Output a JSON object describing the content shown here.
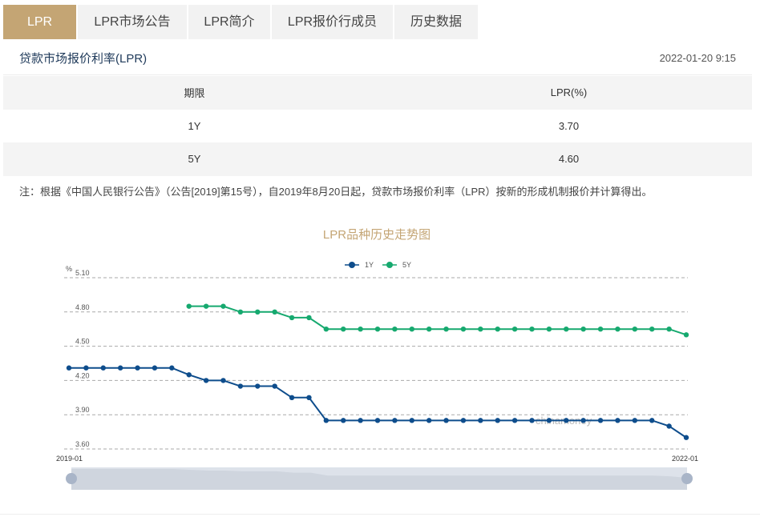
{
  "tabs": [
    {
      "label": "LPR",
      "active": true
    },
    {
      "label": "LPR市场公告"
    },
    {
      "label": "LPR简介"
    },
    {
      "label": "LPR报价行成员"
    },
    {
      "label": "历史数据"
    }
  ],
  "header": {
    "title": "贷款市场报价利率(LPR)",
    "date": "2022-01-20 9:15"
  },
  "table": {
    "headers": [
      "期限",
      "LPR(%)"
    ],
    "rows": [
      [
        "1Y",
        "3.70"
      ],
      [
        "5Y",
        "4.60"
      ]
    ]
  },
  "note": "注：根据《中国人民银行公告》（公告[2019]第15号），自2019年8月20日起，贷款市场报价利率（LPR）按新的形成机制报价并计算得出。",
  "chart_data": {
    "type": "line",
    "title": "LPR品种历史走势图",
    "ylabel": "%",
    "ylim": [
      3.6,
      5.1
    ],
    "yticks": [
      "5.10",
      "4.80",
      "4.50",
      "4.20",
      "3.90",
      "3.60"
    ],
    "x_start": "2019-01",
    "x_end": "2022-01",
    "watermark": "chinamoney",
    "grid": true,
    "legend": "top-center",
    "series": [
      {
        "name": "1Y",
        "color": "#0e4d8c",
        "values": [
          4.31,
          4.31,
          4.31,
          4.31,
          4.31,
          4.31,
          4.31,
          4.25,
          4.2,
          4.2,
          4.15,
          4.15,
          4.15,
          4.05,
          4.05,
          3.85,
          3.85,
          3.85,
          3.85,
          3.85,
          3.85,
          3.85,
          3.85,
          3.85,
          3.85,
          3.85,
          3.85,
          3.85,
          3.85,
          3.85,
          3.85,
          3.85,
          3.85,
          3.85,
          3.85,
          3.8,
          3.7
        ]
      },
      {
        "name": "5Y",
        "color": "#16a96f",
        "values": [
          null,
          null,
          null,
          null,
          null,
          null,
          null,
          4.85,
          4.85,
          4.85,
          4.8,
          4.8,
          4.8,
          4.75,
          4.75,
          4.65,
          4.65,
          4.65,
          4.65,
          4.65,
          4.65,
          4.65,
          4.65,
          4.65,
          4.65,
          4.65,
          4.65,
          4.65,
          4.65,
          4.65,
          4.65,
          4.65,
          4.65,
          4.65,
          4.65,
          4.65,
          4.6
        ]
      }
    ]
  }
}
